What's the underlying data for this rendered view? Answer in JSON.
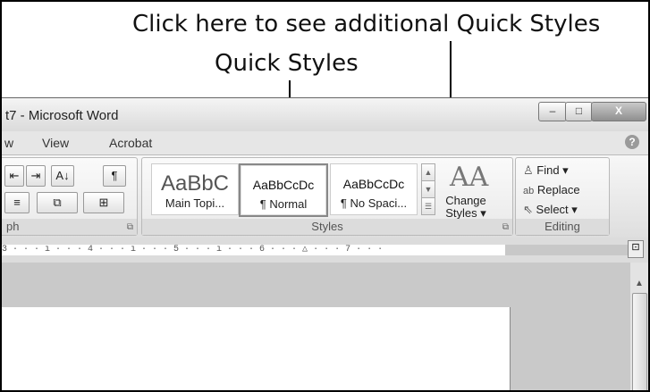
{
  "annotations": {
    "top": "Click here to see additional Quick Styles",
    "quick_styles": "Quick Styles"
  },
  "window": {
    "title": "t7 - Microsoft Word",
    "buttons": {
      "minimize": "–",
      "maximize": "□",
      "close": "X"
    }
  },
  "tabs": [
    "w",
    "View",
    "Acrobat"
  ],
  "help": "?",
  "ribbon": {
    "paragraph": {
      "label": "ph",
      "buttons": [
        "⇤",
        "⇥",
        "A↓",
        "¶",
        "≡",
        "⧉",
        "⊞"
      ]
    },
    "styles": {
      "label": "Styles",
      "items": [
        {
          "preview": "AaBbC",
          "name": "Main Topi..."
        },
        {
          "preview": "AaBbCcDc",
          "name": "¶ Normal"
        },
        {
          "preview": "AaBbCcDc",
          "name": "¶ No Spaci..."
        }
      ],
      "change_styles": {
        "glyph": "AA",
        "line1": "Change",
        "line2": "Styles ▾"
      }
    },
    "editing": {
      "label": "Editing",
      "find": "Find ▾",
      "replace": "Replace",
      "select": "Select ▾"
    }
  },
  "ruler": {
    "text": "3 · · · ı · · · 4 · · · ı · · · 5 · · · ı · · · 6 · · · △ · · · 7 · · ·"
  },
  "colors": {
    "ribbon_bg": "#e9e9e9",
    "window_title_bg": "#dadada",
    "document_bg": "#c9c9c9"
  }
}
